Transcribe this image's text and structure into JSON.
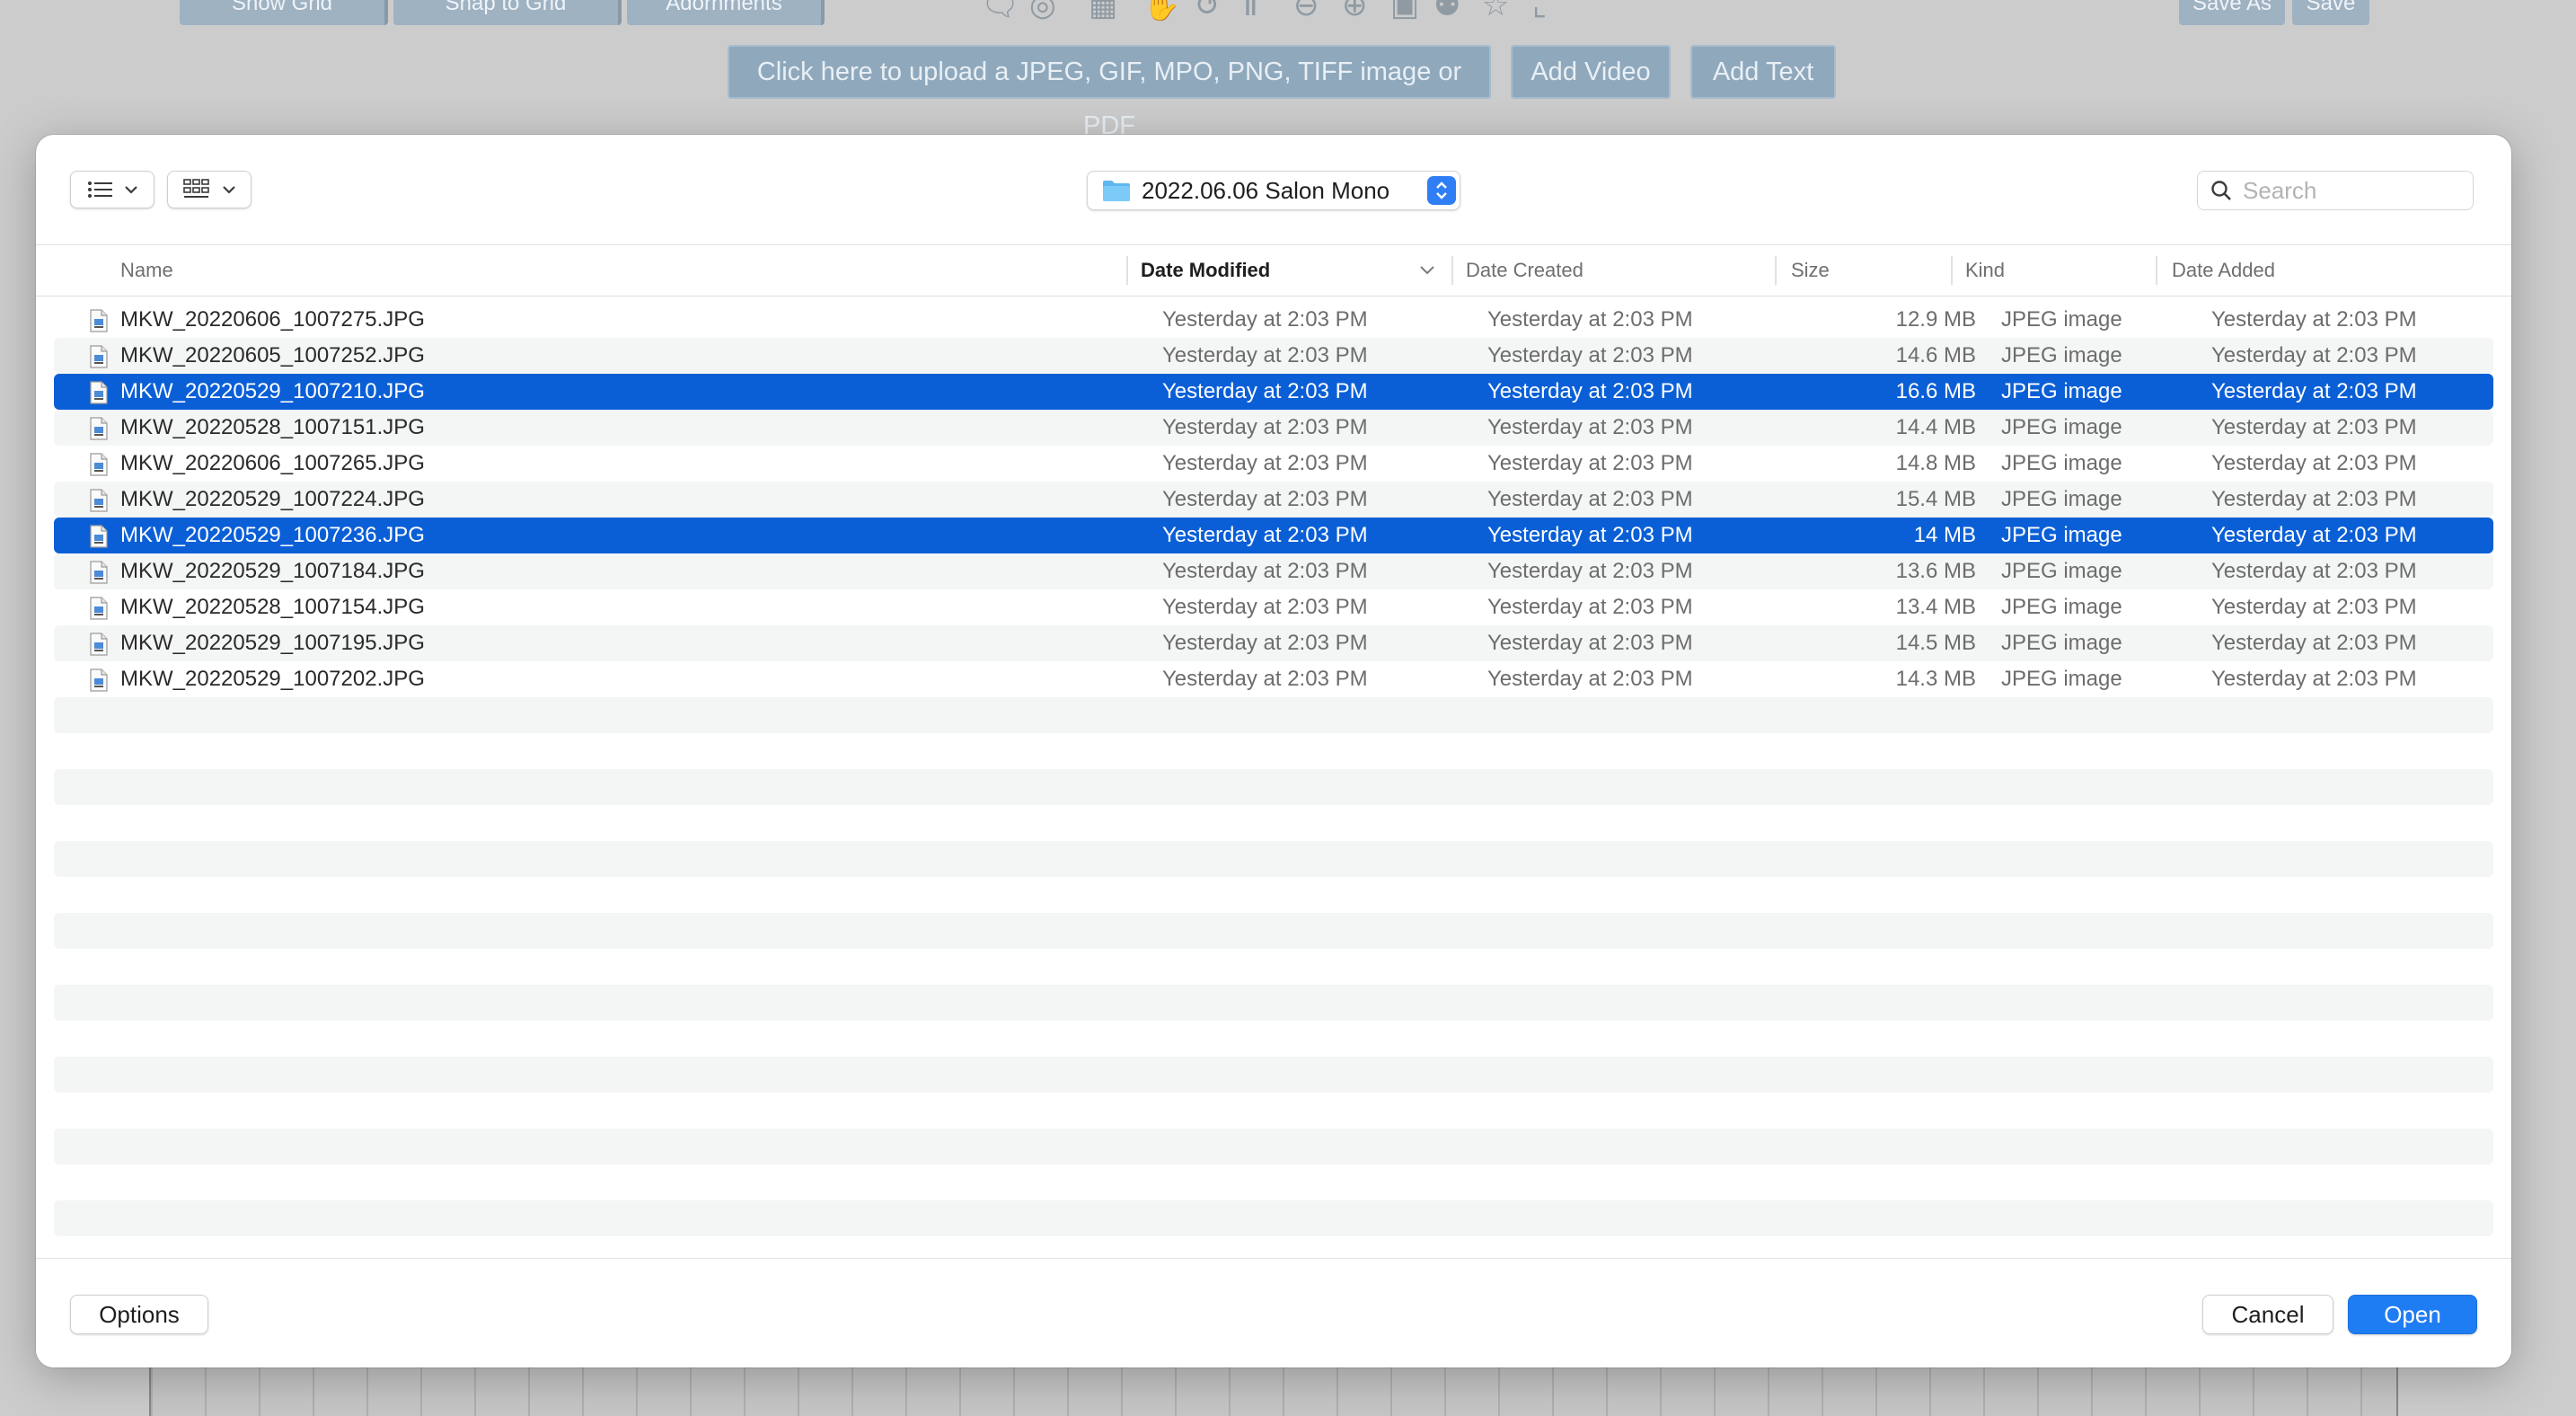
{
  "background": {
    "toolbar": {
      "show_grid": "Show Grid",
      "snap_to_grid": "Snap to Grid",
      "adornments": "Adornments",
      "save_as": "Save As",
      "save": "Save"
    },
    "upload_label": "Click here to upload a JPEG, GIF, MPO, PNG, TIFF image or PDF",
    "add_video": "Add Video",
    "add_text": "Add Text"
  },
  "dialog": {
    "view_list_icon": "list-view-icon",
    "view_grid_icon": "icon-grid-view-icon",
    "folder_name": "2022.06.06 Salon Mono",
    "search_placeholder": "Search",
    "columns": {
      "name": "Name",
      "date_modified": "Date Modified",
      "date_created": "Date Created",
      "size": "Size",
      "kind": "Kind",
      "date_added": "Date Added"
    },
    "sorted_column": "date_modified",
    "files": [
      {
        "name": "MKW_20220606_1007275.JPG",
        "modified": "Yesterday at 2:03 PM",
        "created": "Yesterday at 2:03 PM",
        "size": "12.9 MB",
        "kind": "JPEG image",
        "added": "Yesterday at 2:03 PM",
        "selected": false
      },
      {
        "name": "MKW_20220605_1007252.JPG",
        "modified": "Yesterday at 2:03 PM",
        "created": "Yesterday at 2:03 PM",
        "size": "14.6 MB",
        "kind": "JPEG image",
        "added": "Yesterday at 2:03 PM",
        "selected": false
      },
      {
        "name": "MKW_20220529_1007210.JPG",
        "modified": "Yesterday at 2:03 PM",
        "created": "Yesterday at 2:03 PM",
        "size": "16.6 MB",
        "kind": "JPEG image",
        "added": "Yesterday at 2:03 PM",
        "selected": true
      },
      {
        "name": "MKW_20220528_1007151.JPG",
        "modified": "Yesterday at 2:03 PM",
        "created": "Yesterday at 2:03 PM",
        "size": "14.4 MB",
        "kind": "JPEG image",
        "added": "Yesterday at 2:03 PM",
        "selected": false
      },
      {
        "name": "MKW_20220606_1007265.JPG",
        "modified": "Yesterday at 2:03 PM",
        "created": "Yesterday at 2:03 PM",
        "size": "14.8 MB",
        "kind": "JPEG image",
        "added": "Yesterday at 2:03 PM",
        "selected": false
      },
      {
        "name": "MKW_20220529_1007224.JPG",
        "modified": "Yesterday at 2:03 PM",
        "created": "Yesterday at 2:03 PM",
        "size": "15.4 MB",
        "kind": "JPEG image",
        "added": "Yesterday at 2:03 PM",
        "selected": false
      },
      {
        "name": "MKW_20220529_1007236.JPG",
        "modified": "Yesterday at 2:03 PM",
        "created": "Yesterday at 2:03 PM",
        "size": "14 MB",
        "kind": "JPEG image",
        "added": "Yesterday at 2:03 PM",
        "selected": true
      },
      {
        "name": "MKW_20220529_1007184.JPG",
        "modified": "Yesterday at 2:03 PM",
        "created": "Yesterday at 2:03 PM",
        "size": "13.6 MB",
        "kind": "JPEG image",
        "added": "Yesterday at 2:03 PM",
        "selected": false
      },
      {
        "name": "MKW_20220528_1007154.JPG",
        "modified": "Yesterday at 2:03 PM",
        "created": "Yesterday at 2:03 PM",
        "size": "13.4 MB",
        "kind": "JPEG image",
        "added": "Yesterday at 2:03 PM",
        "selected": false
      },
      {
        "name": "MKW_20220529_1007195.JPG",
        "modified": "Yesterday at 2:03 PM",
        "created": "Yesterday at 2:03 PM",
        "size": "14.5 MB",
        "kind": "JPEG image",
        "added": "Yesterday at 2:03 PM",
        "selected": false
      },
      {
        "name": "MKW_20220529_1007202.JPG",
        "modified": "Yesterday at 2:03 PM",
        "created": "Yesterday at 2:03 PM",
        "size": "14.3 MB",
        "kind": "JPEG image",
        "added": "Yesterday at 2:03 PM",
        "selected": false
      }
    ],
    "options_label": "Options",
    "cancel_label": "Cancel",
    "open_label": "Open"
  },
  "colors": {
    "selection": "#0a5fd7",
    "primary_button": "#1f7df4",
    "row_alt": "#f4f5f5"
  }
}
